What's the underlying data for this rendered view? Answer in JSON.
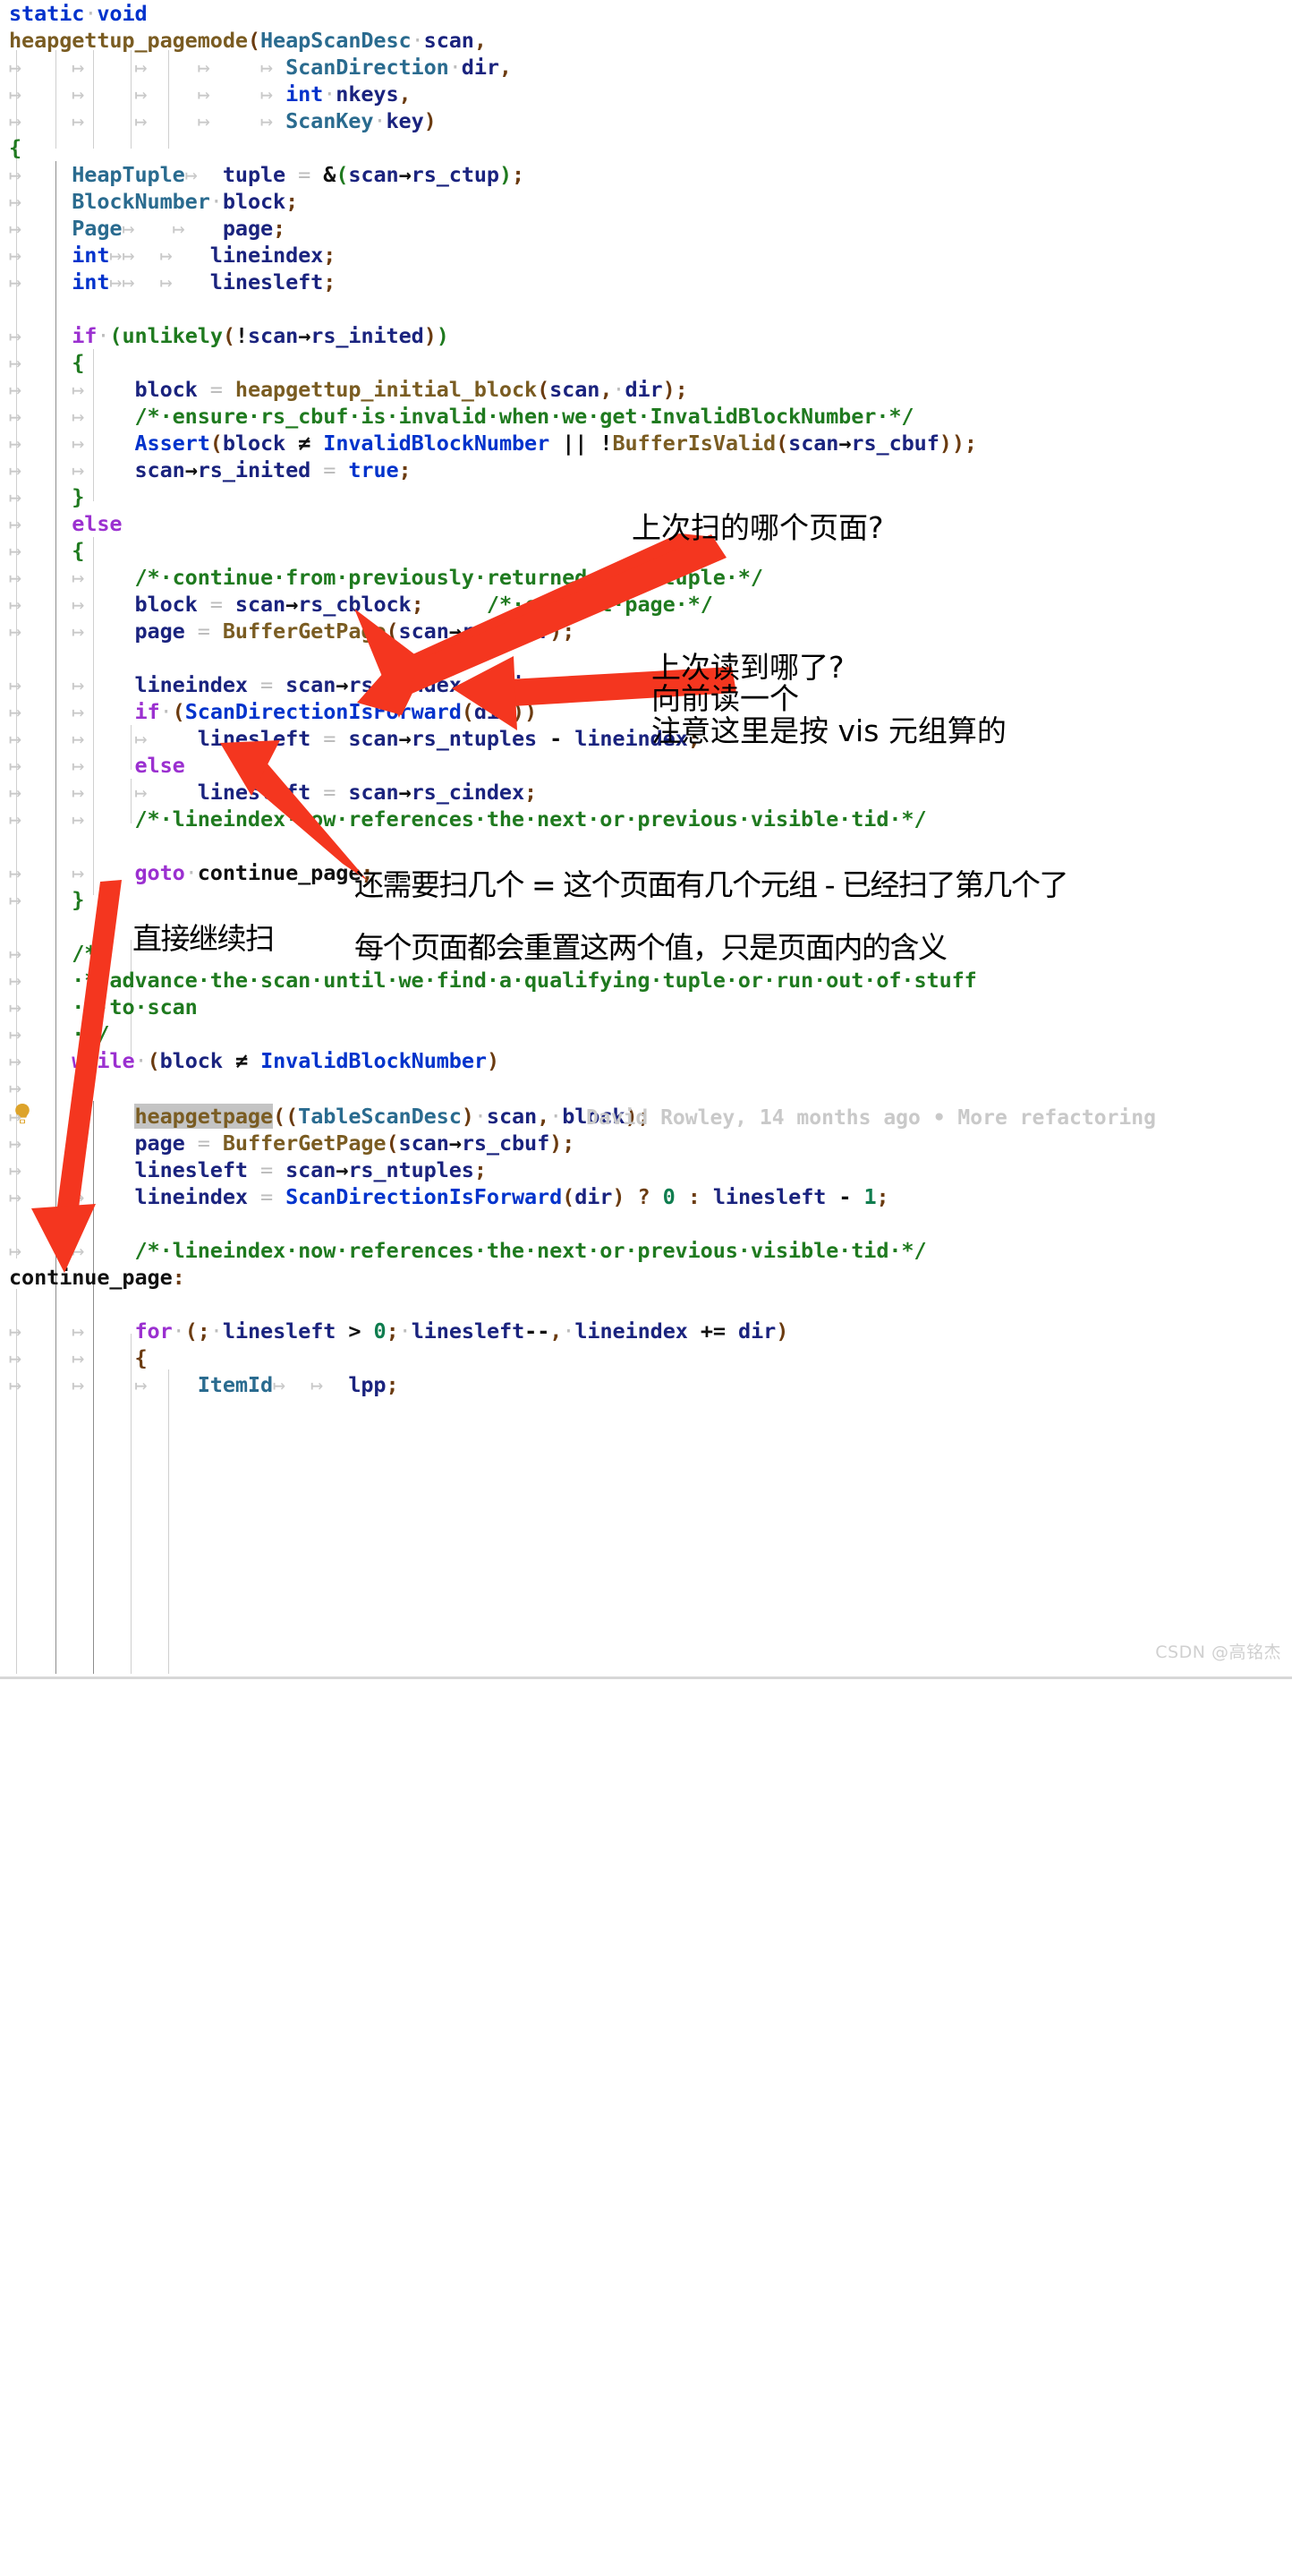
{
  "editor": {
    "language": "C",
    "blame": "David Rowley, 14 months ago • More refactoring",
    "highlighted_token": "heapgetpage",
    "bulb_icon": "lightbulb-icon"
  },
  "code": {
    "lines": [
      "static void",
      "heapgettup_pagemode(HeapScanDesc scan,",
      "                    ScanDirection dir,",
      "                    int nkeys,",
      "                    ScanKey key)",
      "{",
      "    HeapTuple   tuple = &(scan->rs_ctup);",
      "    BlockNumber block;",
      "    Page        page;",
      "    int         lineindex;",
      "    int         linesleft;",
      "",
      "    if (unlikely(!scan->rs_inited))",
      "    {",
      "        block = heapgettup_initial_block(scan, dir);",
      "        /* ensure rs_cbuf is invalid when we get InvalidBlockNumber */",
      "        Assert(block != InvalidBlockNumber || !BufferIsValid(scan->rs_cbuf));",
      "        scan->rs_inited = true;",
      "    }",
      "    else",
      "    {",
      "        /* continue from previously returned page/tuple */",
      "        block = scan->rs_cblock;    /* current page */",
      "        page = BufferGetPage(scan->rs_cbuf);",
      "",
      "        lineindex = scan->rs_cindex + dir;",
      "        if (ScanDirectionIsForward(dir))",
      "            linesleft = scan->rs_ntuples - lineindex;",
      "        else",
      "            linesleft = scan->rs_cindex;",
      "        /* lineindex now references the next or previous visible tid */",
      "",
      "        goto continue_page;",
      "    }",
      "",
      "    /*",
      "     * advance the scan until we find a qualifying tuple or run out of stuff",
      "     * to scan",
      "     */",
      "    while (block != InvalidBlockNumber)",
      "    {",
      "        heapgetpage((TableScanDesc) scan, block);",
      "        page = BufferGetPage(scan->rs_cbuf);",
      "        linesleft = scan->rs_ntuples;",
      "        lineindex = ScanDirectionIsForward(dir) ? 0 : linesleft - 1;",
      "",
      "        /* lineindex now references the next or previous visible tid */",
      "continue_page:",
      "",
      "        for (; linesleft > 0; linesleft--, lineindex += dir)",
      "        {",
      "            ItemId      lpp;"
    ]
  },
  "annotations": {
    "note_page": "上次扫的哪个页面?",
    "note_read_1": "上次读到哪了?",
    "note_read_2": "向前读一个",
    "note_read_3": "注意这里是按 vis 元组算的",
    "note_count": "还需要扫几个 = 这个页面有几个元组 - 已经扫了第几个了",
    "note_continue": "直接继续扫",
    "note_reset": "每个页面都会重置这两个值，只是页面内的含义",
    "color": "#f4361f"
  },
  "watermark": {
    "text": "CSDN @高铭杰"
  }
}
